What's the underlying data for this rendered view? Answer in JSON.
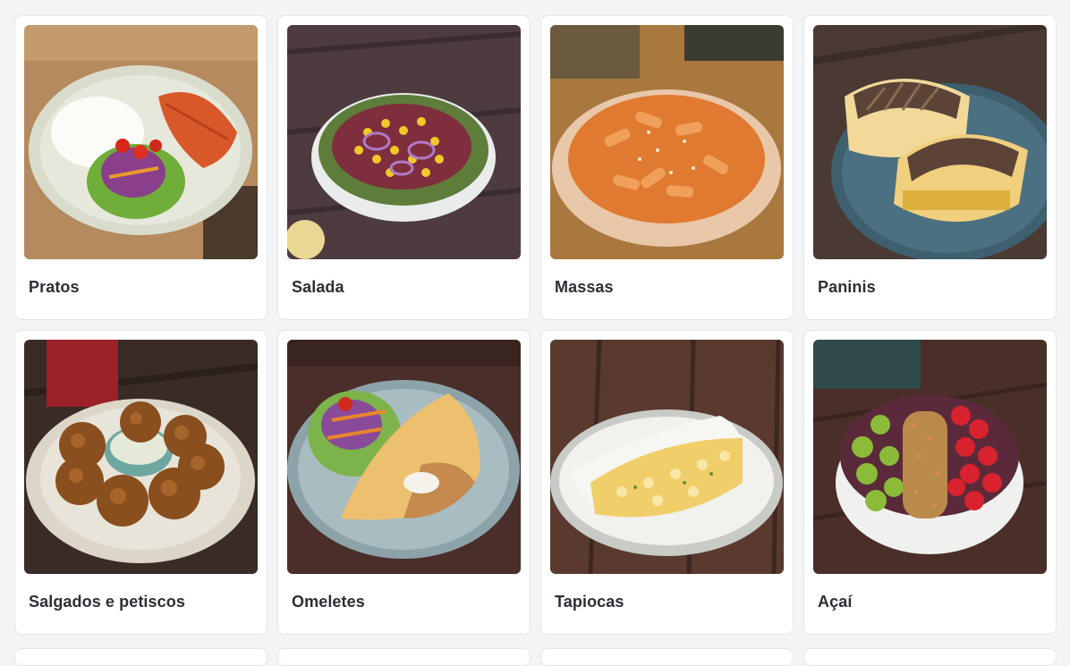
{
  "categories": [
    {
      "label": "Pratos",
      "image": "plate-of-rice-salmon-salad"
    },
    {
      "label": "Salada",
      "image": "salad-bowl-corn-onion"
    },
    {
      "label": "Massas",
      "image": "pasta-bowl-rigatoni"
    },
    {
      "label": "Paninis",
      "image": "grilled-panini-sandwich"
    },
    {
      "label": "Salgados e petiscos",
      "image": "fried-croquettes-with-dip"
    },
    {
      "label": "Omeletes",
      "image": "omelette-with-salad"
    },
    {
      "label": "Tapiocas",
      "image": "tapioca-crepe"
    },
    {
      "label": "Açaí",
      "image": "acai-bowl-kiwi-strawberry-granola"
    }
  ]
}
